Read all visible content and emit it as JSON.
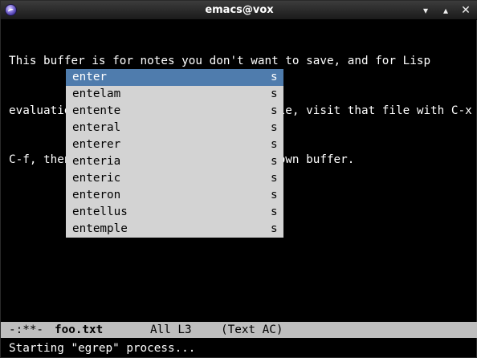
{
  "window": {
    "title": "emacs@vox",
    "buttons": {
      "minimize": "▾",
      "maximize": "▴",
      "close": "✕"
    }
  },
  "buffer": {
    "lines": [
      "This buffer is for notes you don't want to save, and for Lisp",
      "evaluation.  If you want to create a file, visit that file with C-x",
      "C-f, then ente the text in that file's own buffer."
    ]
  },
  "completion": {
    "selected_index": 0,
    "items": [
      {
        "word": "enter",
        "annotation": "s"
      },
      {
        "word": "entelam",
        "annotation": "s"
      },
      {
        "word": "entente",
        "annotation": "s"
      },
      {
        "word": "enteral",
        "annotation": "s"
      },
      {
        "word": "enterer",
        "annotation": "s"
      },
      {
        "word": "enteria",
        "annotation": "s"
      },
      {
        "word": "enteric",
        "annotation": "s"
      },
      {
        "word": "enteron",
        "annotation": "s"
      },
      {
        "word": "entellus",
        "annotation": "s"
      },
      {
        "word": "entemple",
        "annotation": "s"
      }
    ]
  },
  "modeline": {
    "status": "-:**-",
    "buffer_name": "foo.txt",
    "position": "All L3",
    "modes": "(Text AC)"
  },
  "echo_area": "Starting \"egrep\" process...",
  "colors": {
    "background": "#000000",
    "text": "#ffffff",
    "popup_bg": "#d3d3d3",
    "popup_selected": "#4f7cad",
    "modeline_bg": "#bebebe"
  }
}
